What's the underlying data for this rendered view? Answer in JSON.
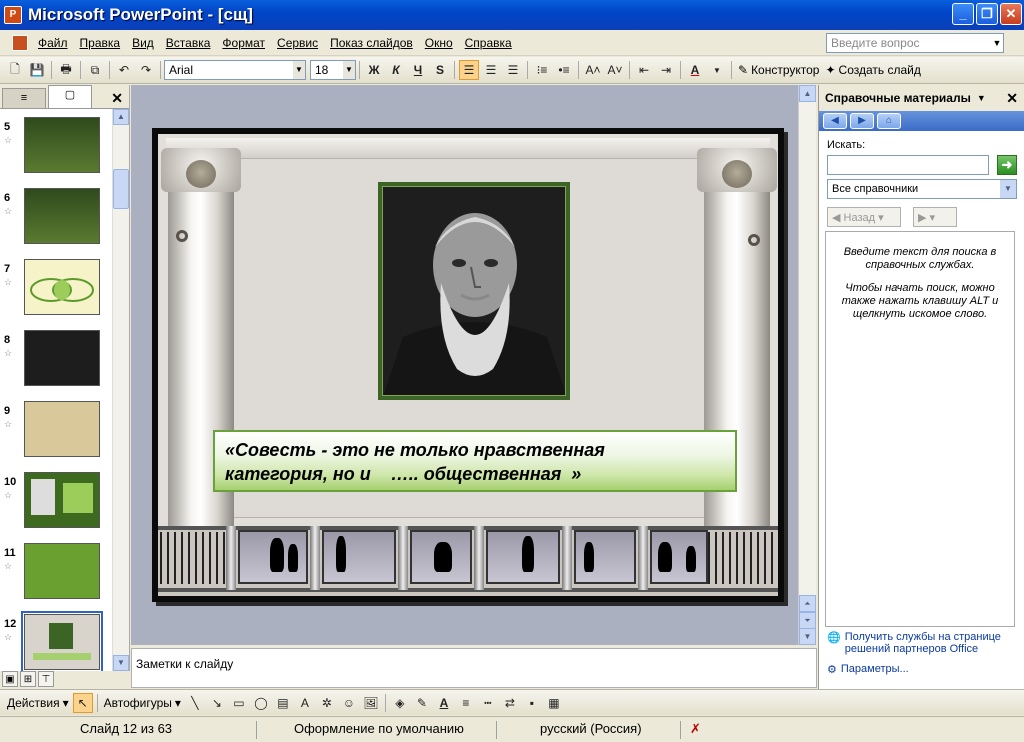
{
  "app": {
    "title": "Microsoft PowerPoint - [сщ]",
    "icon_label": "P"
  },
  "window_buttons": {
    "minimize": "_",
    "maximize": "❐",
    "close": "✕"
  },
  "menu": {
    "items": [
      "Файл",
      "Правка",
      "Вид",
      "Вставка",
      "Формат",
      "Сервис",
      "Показ слайдов",
      "Окно",
      "Справка"
    ],
    "ask_placeholder": "Введите вопрос"
  },
  "toolbar": {
    "font_name": "Arial",
    "font_size": "18",
    "bold": "Ж",
    "italic": "К",
    "underline": "Ч",
    "shadow": "S",
    "increase_font": "A˄",
    "decrease_font": "A˅",
    "designer_label": "Конструктор",
    "new_slide_label": "Создать слайд"
  },
  "left_pane": {
    "tab_outline": "≡",
    "tab_slides": "▢",
    "close": "✕",
    "slides": [
      {
        "num": "5",
        "star": "☆",
        "style": "green-dark"
      },
      {
        "num": "6",
        "star": "☆",
        "style": "green-dark"
      },
      {
        "num": "7",
        "star": "☆",
        "style": "yellow-venn"
      },
      {
        "num": "8",
        "star": "☆",
        "style": "dark-table"
      },
      {
        "num": "9",
        "star": "☆",
        "style": "beige-text"
      },
      {
        "num": "10",
        "star": "☆",
        "style": "portrait-green"
      },
      {
        "num": "11",
        "star": "☆",
        "style": "green-text"
      },
      {
        "num": "12",
        "star": "☆",
        "style": "current"
      }
    ]
  },
  "slide": {
    "quote_line1": "«Совесть - это не только нравственная",
    "quote_line2": "категория, но и    ….. общественная  »"
  },
  "notes": {
    "placeholder": "Заметки к слайду"
  },
  "task_pane": {
    "title": "Справочные материалы",
    "search_label": "Искать:",
    "search_value": "",
    "go": "➜",
    "source": "Все справочники",
    "back_label": "Назад",
    "info_p1": "Введите текст для поиска в справочных службах.",
    "info_p2": "Чтобы начать поиск, можно также нажать клавишу ALT и щелкнуть искомое слово.",
    "link_services": "Получить службы на странице решений партнеров Office",
    "link_params": "Параметры..."
  },
  "drawing_toolbar": {
    "actions": "Действия",
    "autoshapes": "Автофигуры"
  },
  "status": {
    "slide_pos": "Слайд 12 из 63",
    "design": "Оформление по умолчанию",
    "language": "русский (Россия)"
  },
  "colors": {
    "title_bar": "#0046c8",
    "slide_frame": "#0a0a0a",
    "quote_green": "#a6d070",
    "portrait_frame": "#3c6424"
  }
}
